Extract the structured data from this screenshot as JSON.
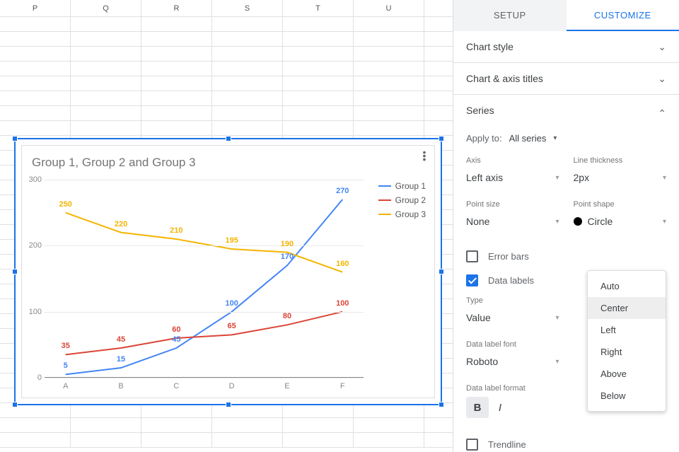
{
  "spreadsheet": {
    "cols": [
      "P",
      "Q",
      "R",
      "S",
      "T",
      "U"
    ]
  },
  "panel": {
    "tabs": {
      "setup": "SETUP",
      "customize": "CUSTOMIZE"
    },
    "sections": {
      "chart_style": "Chart style",
      "chart_axis_titles": "Chart & axis titles",
      "series": "Series"
    },
    "apply_to_label": "Apply to:",
    "apply_to_value": "All series",
    "axis": {
      "label": "Axis",
      "value": "Left axis"
    },
    "line_thickness": {
      "label": "Line thickness",
      "value": "2px"
    },
    "point_size": {
      "label": "Point size",
      "value": "None"
    },
    "point_shape": {
      "label": "Point shape",
      "value": "Circle"
    },
    "error_bars": "Error bars",
    "data_labels": "Data labels",
    "type": {
      "label": "Type",
      "value": "Value"
    },
    "data_label_font": {
      "label": "Data label font",
      "value": "Roboto"
    },
    "data_label_format": "Data label format",
    "format_auto": "Auto",
    "trendline": "Trendline",
    "position_popup": {
      "auto": "Auto",
      "center": "Center",
      "left": "Left",
      "right": "Right",
      "above": "Above",
      "below": "Below"
    }
  },
  "chart_data": {
    "type": "line",
    "title": "Group 1, Group 2 and Group 3",
    "categories": [
      "A",
      "B",
      "C",
      "D",
      "E",
      "F"
    ],
    "series": [
      {
        "name": "Group 1",
        "color": "#4285f4",
        "values": [
          5,
          15,
          45,
          100,
          170,
          270
        ]
      },
      {
        "name": "Group 2",
        "color": "#db4437",
        "values": [
          35,
          45,
          60,
          65,
          80,
          100
        ]
      },
      {
        "name": "Group 3",
        "color": "#f4b400",
        "values": [
          250,
          220,
          210,
          195,
          190,
          160
        ]
      }
    ],
    "ylim": [
      0,
      300
    ],
    "yticks": [
      0,
      100,
      200,
      300
    ],
    "xlabel": "",
    "ylabel": ""
  }
}
